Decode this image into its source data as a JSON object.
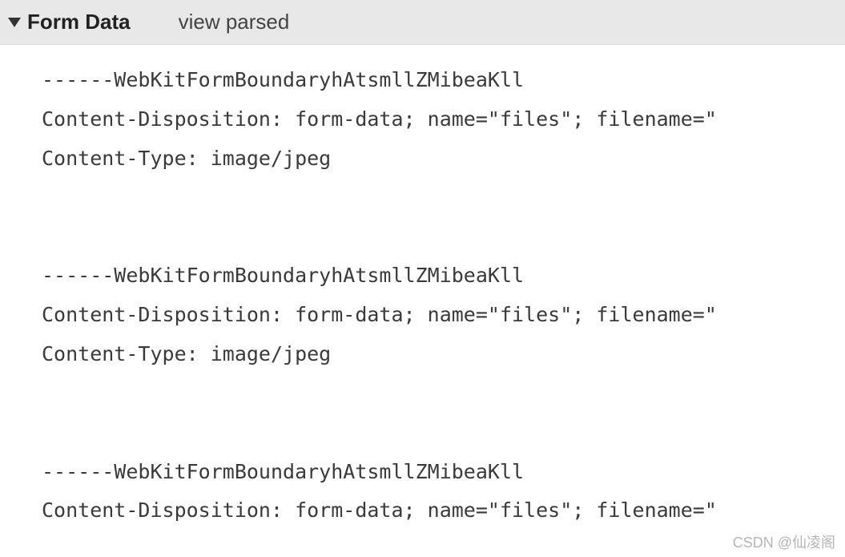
{
  "header": {
    "title": "Form Data",
    "view_parsed_label": "view parsed"
  },
  "payload": {
    "parts": [
      {
        "boundary": "------WebKitFormBoundaryhAtsmllZMibeaKll",
        "disposition": "Content-Disposition: form-data; name=\"files\"; filename=\"",
        "content_type": "Content-Type: image/jpeg"
      },
      {
        "boundary": "------WebKitFormBoundaryhAtsmllZMibeaKll",
        "disposition": "Content-Disposition: form-data; name=\"files\"; filename=\"",
        "content_type": "Content-Type: image/jpeg"
      },
      {
        "boundary": "------WebKitFormBoundaryhAtsmllZMibeaKll",
        "disposition": "Content-Disposition: form-data; name=\"files\"; filename=\""
      }
    ]
  },
  "watermark": "CSDN @仙凌阁"
}
